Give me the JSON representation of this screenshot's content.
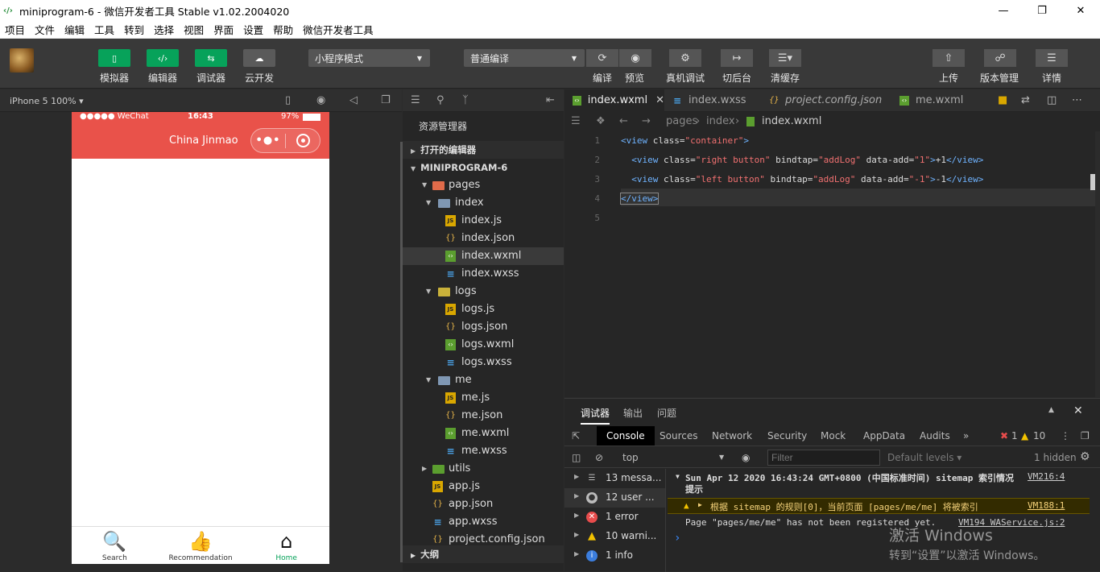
{
  "window": {
    "title": "miniprogram-6 - 微信开发者工具 Stable v1.02.2004020",
    "app_icon": "‹/›"
  },
  "menu": [
    "项目",
    "文件",
    "编辑",
    "工具",
    "转到",
    "选择",
    "视图",
    "界面",
    "设置",
    "帮助",
    "微信开发者工具"
  ],
  "toolbar": {
    "simulator": "模拟器",
    "editor": "编辑器",
    "debugger": "调试器",
    "cloud": "云开发",
    "mode_select": "小程序模式",
    "compile_select": "普通编译",
    "compile": "编译",
    "preview": "预览",
    "remote_debug": "真机调试",
    "background": "切后台",
    "clear_cache": "清缓存",
    "upload": "上传",
    "version": "版本管理",
    "details": "详情"
  },
  "simulator": {
    "device": "iPhone 5 100% ▾",
    "status_left": "●●●●● WeChat",
    "status_time": "16:43",
    "status_battery": "97%",
    "nav_title": "China Jinmao",
    "tabs": [
      {
        "label": "Search",
        "icon": "search-icon",
        "active": false
      },
      {
        "label": "Recommendation",
        "icon": "thumbs-up-icon",
        "active": false
      },
      {
        "label": "Home",
        "icon": "home-icon",
        "active": true
      }
    ]
  },
  "explorer": {
    "title": "资源管理器",
    "open_editors": "打开的编辑器",
    "project": "MINIPROGRAM-6",
    "outline": "大纲",
    "tree": [
      {
        "name": "pages",
        "type": "folder red",
        "depth": 1,
        "arrow": "▼"
      },
      {
        "name": "index",
        "type": "folder",
        "depth": 2,
        "arrow": "▼"
      },
      {
        "name": "index.js",
        "type": "js",
        "depth": 3
      },
      {
        "name": "index.json",
        "type": "json",
        "depth": 3
      },
      {
        "name": "index.wxml",
        "type": "wxml",
        "depth": 3,
        "selected": true
      },
      {
        "name": "index.wxss",
        "type": "wxss",
        "depth": 3
      },
      {
        "name": "logs",
        "type": "folder yl",
        "depth": 2,
        "arrow": "▼"
      },
      {
        "name": "logs.js",
        "type": "js",
        "depth": 3
      },
      {
        "name": "logs.json",
        "type": "json",
        "depth": 3
      },
      {
        "name": "logs.wxml",
        "type": "wxml",
        "depth": 3
      },
      {
        "name": "logs.wxss",
        "type": "wxss",
        "depth": 3
      },
      {
        "name": "me",
        "type": "folder",
        "depth": 2,
        "arrow": "▼"
      },
      {
        "name": "me.js",
        "type": "js",
        "depth": 3
      },
      {
        "name": "me.json",
        "type": "json",
        "depth": 3
      },
      {
        "name": "me.wxml",
        "type": "wxml",
        "depth": 3
      },
      {
        "name": "me.wxss",
        "type": "wxss",
        "depth": 3
      },
      {
        "name": "utils",
        "type": "folder gr",
        "depth": 1,
        "arrow": "▶"
      },
      {
        "name": "app.js",
        "type": "js",
        "depth": 1
      },
      {
        "name": "app.json",
        "type": "json",
        "depth": 1
      },
      {
        "name": "app.wxss",
        "type": "wxss",
        "depth": 1
      },
      {
        "name": "project.config.json",
        "type": "json",
        "depth": 1
      }
    ]
  },
  "editor": {
    "tabs": [
      {
        "label": "index.wxml",
        "type": "wxml",
        "active": true
      },
      {
        "label": "index.wxss",
        "type": "wxss",
        "active": false
      },
      {
        "label": "project.config.json",
        "type": "json",
        "active": false
      },
      {
        "label": "me.wxml",
        "type": "wxml",
        "active": false
      }
    ],
    "breadcrumb": [
      "pages",
      "index",
      "index.wxml"
    ],
    "line_numbers": [
      "1",
      "2",
      "3",
      "4",
      "5"
    ]
  },
  "devtools": {
    "top_tabs": [
      "调试器",
      "输出",
      "问题"
    ],
    "tabs": [
      "Console",
      "Sources",
      "Network",
      "Security",
      "Mock",
      "AppData",
      "Audits"
    ],
    "error_count": "1",
    "warning_count": "10",
    "context": "top",
    "filter_placeholder": "Filter",
    "levels": "Default levels ▾",
    "hidden": "1 hidden",
    "sidebar": [
      {
        "label": "13 messa...",
        "kind": "list"
      },
      {
        "label": "12 user ...",
        "kind": "user"
      },
      {
        "label": "1 error",
        "kind": "error"
      },
      {
        "label": "10 warni...",
        "kind": "warning"
      },
      {
        "label": "1 info",
        "kind": "info"
      }
    ],
    "log_group": "Sun Apr 12 2020 16:43:24 GMT+0800 (中国标准时间) sitemap 索引情况",
    "log_group_src": "VM216:4",
    "log_group_sub": "提示",
    "log_warning": "根据 sitemap 的规则[0]，当前页面 [pages/me/me] 将被索引",
    "log_warning_src": "VM188:1",
    "log_info": "Page \"pages/me/me\" has not been registered yet.",
    "log_info_src": "VM194 WAService.js:2",
    "prompt": "›"
  },
  "watermark": {
    "line1": "激活 Windows",
    "line2": "转到“设置”以激活 Windows。"
  }
}
